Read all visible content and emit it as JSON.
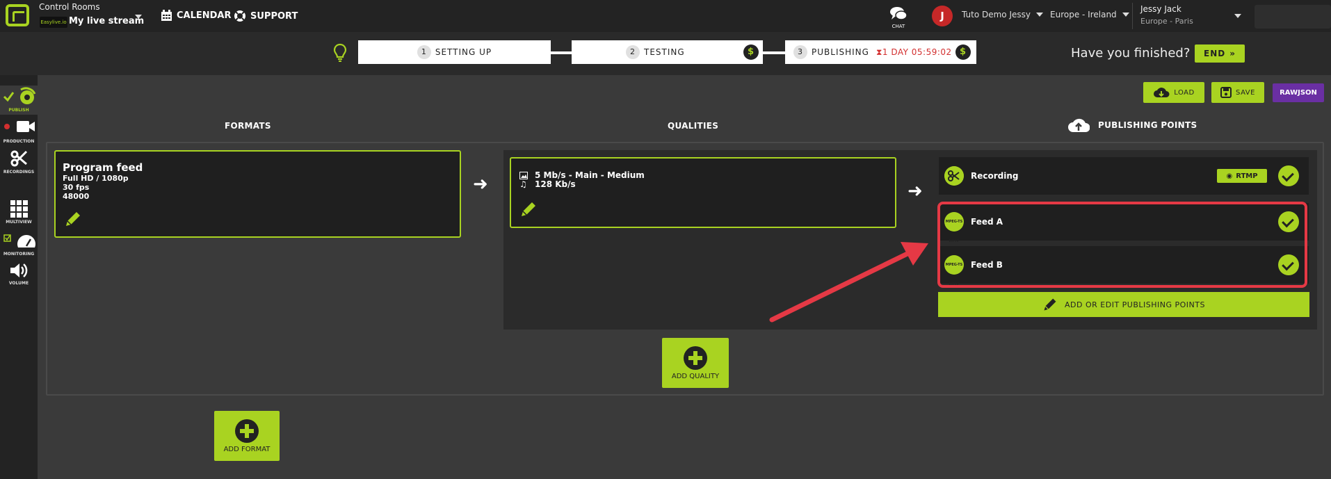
{
  "topbar": {
    "app_title": "Control Rooms",
    "brand_tag": "Easylive.io",
    "stream_name": "My live stream",
    "nav": {
      "calendar": "CALENDAR",
      "support": "SUPPORT"
    },
    "chat_label": "CHAT",
    "avatar_letter": "J",
    "account": "Tuto Demo Jessy",
    "region": "Europe - Ireland",
    "user_name": "Jessy Jack",
    "user_timezone": "Europe - Paris"
  },
  "steps": [
    {
      "num": "1",
      "label": "SETTING UP"
    },
    {
      "num": "2",
      "label": "TESTING"
    },
    {
      "num": "3",
      "label": "PUBLISHING"
    }
  ],
  "timer": "1 DAY 05:59:02",
  "dollar_symbol": "$",
  "finished_question": "Have you finished?",
  "end_label": "END",
  "sidebar": {
    "publish": "PUBLISH",
    "production": "PRODUCTION",
    "recordings": "RECORDINGS",
    "multiview": "MULTIVIEW",
    "monitoring": "MONITORING",
    "volume": "VOLUME"
  },
  "toolbar": {
    "load": "LOAD",
    "save": "SAVE",
    "rawjson": "RAWJSON"
  },
  "columns": {
    "formats": "FORMATS",
    "qualities": "QUALITIES",
    "publishing_points": "PUBLISHING POINTS"
  },
  "format": {
    "title": "Program feed",
    "resolution": "Full HD / 1080p",
    "fps": "30 fps",
    "audio_rate": "48000"
  },
  "quality": {
    "video": "5 Mb/s  -  Main  -  Medium",
    "audio": "128 Kb/s"
  },
  "publishing_points": [
    {
      "label": "Recording",
      "badge": "RTMP",
      "icon": "scissors-icon"
    },
    {
      "label": "Feed A",
      "icon_text": "MPEG-TS HTTP"
    },
    {
      "label": "Feed B",
      "icon_text": "MPEG-TS HTTP"
    }
  ],
  "add_pp_label": "ADD OR EDIT PUBLISHING POINTS",
  "add_quality_label": "ADD QUALITY",
  "add_format_label": "ADD FORMAT",
  "colors": {
    "accent": "#a9d321",
    "highlight": "#e53945",
    "raw": "#6a2fa3"
  }
}
